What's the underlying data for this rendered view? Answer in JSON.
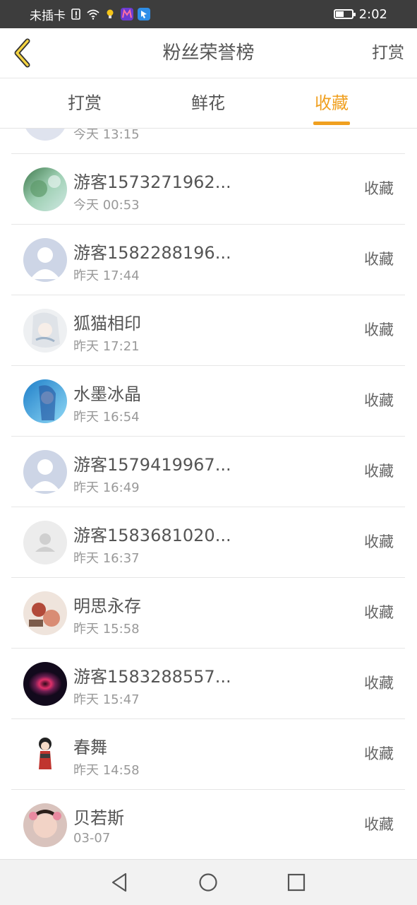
{
  "status_bar": {
    "carrier": "未插卡",
    "time": "2:02",
    "battery_level": 0.5
  },
  "header": {
    "title": "粉丝荣誉榜",
    "right_action": "打赏"
  },
  "tabs": [
    {
      "label": "打赏",
      "active": false
    },
    {
      "label": "鲜花",
      "active": false
    },
    {
      "label": "收藏",
      "active": true
    }
  ],
  "list": {
    "partial_top_time": "今天 13:15",
    "items": [
      {
        "name": "游客1573271962...",
        "time": "今天 00:53",
        "action": "收藏",
        "avatar": "landscape-green"
      },
      {
        "name": "游客1582288196...",
        "time": "昨天 17:44",
        "action": "收藏",
        "avatar": "default-blue"
      },
      {
        "name": "狐猫相印",
        "time": "昨天 17:21",
        "action": "收藏",
        "avatar": "anime-sketch"
      },
      {
        "name": "水墨冰晶",
        "time": "昨天 16:54",
        "action": "收藏",
        "avatar": "anime-blue"
      },
      {
        "name": "游客1579419967...",
        "time": "昨天 16:49",
        "action": "收藏",
        "avatar": "default-blue"
      },
      {
        "name": "游客1583681020...",
        "time": "昨天 16:37",
        "action": "收藏",
        "avatar": "default-gray"
      },
      {
        "name": "明思永存",
        "time": "昨天 15:58",
        "action": "收藏",
        "avatar": "illustration-warm"
      },
      {
        "name": "游客1583288557...",
        "time": "昨天 15:47",
        "action": "收藏",
        "avatar": "nebula-eye"
      },
      {
        "name": "春舞",
        "time": "昨天 14:58",
        "action": "收藏",
        "avatar": "chibi-girl"
      },
      {
        "name": "贝若斯",
        "time": "03-07",
        "action": "收藏",
        "avatar": "child-photo"
      }
    ]
  },
  "nav_bar": {
    "icons": [
      "back-triangle-icon",
      "home-circle-icon",
      "recents-square-icon"
    ]
  },
  "colors": {
    "accent": "#f0a020",
    "status_bar_bg": "#3d3d3d",
    "text_primary": "#555555",
    "text_secondary": "#999999",
    "divider": "#e6e6e6"
  }
}
